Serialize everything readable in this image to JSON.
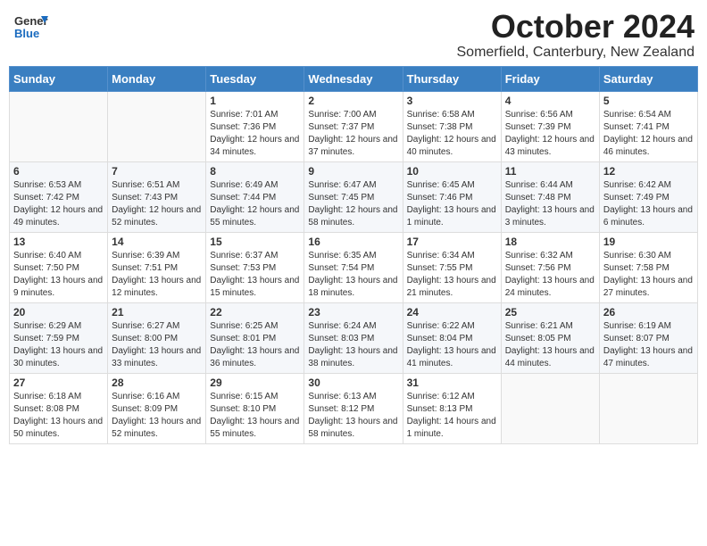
{
  "header": {
    "logo_general": "General",
    "logo_blue": "Blue",
    "month": "October 2024",
    "location": "Somerfield, Canterbury, New Zealand"
  },
  "days_of_week": [
    "Sunday",
    "Monday",
    "Tuesday",
    "Wednesday",
    "Thursday",
    "Friday",
    "Saturday"
  ],
  "weeks": [
    [
      {
        "day": "",
        "sunrise": "",
        "sunset": "",
        "daylight": ""
      },
      {
        "day": "",
        "sunrise": "",
        "sunset": "",
        "daylight": ""
      },
      {
        "day": "1",
        "sunrise": "Sunrise: 7:01 AM",
        "sunset": "Sunset: 7:36 PM",
        "daylight": "Daylight: 12 hours and 34 minutes."
      },
      {
        "day": "2",
        "sunrise": "Sunrise: 7:00 AM",
        "sunset": "Sunset: 7:37 PM",
        "daylight": "Daylight: 12 hours and 37 minutes."
      },
      {
        "day": "3",
        "sunrise": "Sunrise: 6:58 AM",
        "sunset": "Sunset: 7:38 PM",
        "daylight": "Daylight: 12 hours and 40 minutes."
      },
      {
        "day": "4",
        "sunrise": "Sunrise: 6:56 AM",
        "sunset": "Sunset: 7:39 PM",
        "daylight": "Daylight: 12 hours and 43 minutes."
      },
      {
        "day": "5",
        "sunrise": "Sunrise: 6:54 AM",
        "sunset": "Sunset: 7:41 PM",
        "daylight": "Daylight: 12 hours and 46 minutes."
      }
    ],
    [
      {
        "day": "6",
        "sunrise": "Sunrise: 6:53 AM",
        "sunset": "Sunset: 7:42 PM",
        "daylight": "Daylight: 12 hours and 49 minutes."
      },
      {
        "day": "7",
        "sunrise": "Sunrise: 6:51 AM",
        "sunset": "Sunset: 7:43 PM",
        "daylight": "Daylight: 12 hours and 52 minutes."
      },
      {
        "day": "8",
        "sunrise": "Sunrise: 6:49 AM",
        "sunset": "Sunset: 7:44 PM",
        "daylight": "Daylight: 12 hours and 55 minutes."
      },
      {
        "day": "9",
        "sunrise": "Sunrise: 6:47 AM",
        "sunset": "Sunset: 7:45 PM",
        "daylight": "Daylight: 12 hours and 58 minutes."
      },
      {
        "day": "10",
        "sunrise": "Sunrise: 6:45 AM",
        "sunset": "Sunset: 7:46 PM",
        "daylight": "Daylight: 13 hours and 1 minute."
      },
      {
        "day": "11",
        "sunrise": "Sunrise: 6:44 AM",
        "sunset": "Sunset: 7:48 PM",
        "daylight": "Daylight: 13 hours and 3 minutes."
      },
      {
        "day": "12",
        "sunrise": "Sunrise: 6:42 AM",
        "sunset": "Sunset: 7:49 PM",
        "daylight": "Daylight: 13 hours and 6 minutes."
      }
    ],
    [
      {
        "day": "13",
        "sunrise": "Sunrise: 6:40 AM",
        "sunset": "Sunset: 7:50 PM",
        "daylight": "Daylight: 13 hours and 9 minutes."
      },
      {
        "day": "14",
        "sunrise": "Sunrise: 6:39 AM",
        "sunset": "Sunset: 7:51 PM",
        "daylight": "Daylight: 13 hours and 12 minutes."
      },
      {
        "day": "15",
        "sunrise": "Sunrise: 6:37 AM",
        "sunset": "Sunset: 7:53 PM",
        "daylight": "Daylight: 13 hours and 15 minutes."
      },
      {
        "day": "16",
        "sunrise": "Sunrise: 6:35 AM",
        "sunset": "Sunset: 7:54 PM",
        "daylight": "Daylight: 13 hours and 18 minutes."
      },
      {
        "day": "17",
        "sunrise": "Sunrise: 6:34 AM",
        "sunset": "Sunset: 7:55 PM",
        "daylight": "Daylight: 13 hours and 21 minutes."
      },
      {
        "day": "18",
        "sunrise": "Sunrise: 6:32 AM",
        "sunset": "Sunset: 7:56 PM",
        "daylight": "Daylight: 13 hours and 24 minutes."
      },
      {
        "day": "19",
        "sunrise": "Sunrise: 6:30 AM",
        "sunset": "Sunset: 7:58 PM",
        "daylight": "Daylight: 13 hours and 27 minutes."
      }
    ],
    [
      {
        "day": "20",
        "sunrise": "Sunrise: 6:29 AM",
        "sunset": "Sunset: 7:59 PM",
        "daylight": "Daylight: 13 hours and 30 minutes."
      },
      {
        "day": "21",
        "sunrise": "Sunrise: 6:27 AM",
        "sunset": "Sunset: 8:00 PM",
        "daylight": "Daylight: 13 hours and 33 minutes."
      },
      {
        "day": "22",
        "sunrise": "Sunrise: 6:25 AM",
        "sunset": "Sunset: 8:01 PM",
        "daylight": "Daylight: 13 hours and 36 minutes."
      },
      {
        "day": "23",
        "sunrise": "Sunrise: 6:24 AM",
        "sunset": "Sunset: 8:03 PM",
        "daylight": "Daylight: 13 hours and 38 minutes."
      },
      {
        "day": "24",
        "sunrise": "Sunrise: 6:22 AM",
        "sunset": "Sunset: 8:04 PM",
        "daylight": "Daylight: 13 hours and 41 minutes."
      },
      {
        "day": "25",
        "sunrise": "Sunrise: 6:21 AM",
        "sunset": "Sunset: 8:05 PM",
        "daylight": "Daylight: 13 hours and 44 minutes."
      },
      {
        "day": "26",
        "sunrise": "Sunrise: 6:19 AM",
        "sunset": "Sunset: 8:07 PM",
        "daylight": "Daylight: 13 hours and 47 minutes."
      }
    ],
    [
      {
        "day": "27",
        "sunrise": "Sunrise: 6:18 AM",
        "sunset": "Sunset: 8:08 PM",
        "daylight": "Daylight: 13 hours and 50 minutes."
      },
      {
        "day": "28",
        "sunrise": "Sunrise: 6:16 AM",
        "sunset": "Sunset: 8:09 PM",
        "daylight": "Daylight: 13 hours and 52 minutes."
      },
      {
        "day": "29",
        "sunrise": "Sunrise: 6:15 AM",
        "sunset": "Sunset: 8:10 PM",
        "daylight": "Daylight: 13 hours and 55 minutes."
      },
      {
        "day": "30",
        "sunrise": "Sunrise: 6:13 AM",
        "sunset": "Sunset: 8:12 PM",
        "daylight": "Daylight: 13 hours and 58 minutes."
      },
      {
        "day": "31",
        "sunrise": "Sunrise: 6:12 AM",
        "sunset": "Sunset: 8:13 PM",
        "daylight": "Daylight: 14 hours and 1 minute."
      },
      {
        "day": "",
        "sunrise": "",
        "sunset": "",
        "daylight": ""
      },
      {
        "day": "",
        "sunrise": "",
        "sunset": "",
        "daylight": ""
      }
    ]
  ]
}
